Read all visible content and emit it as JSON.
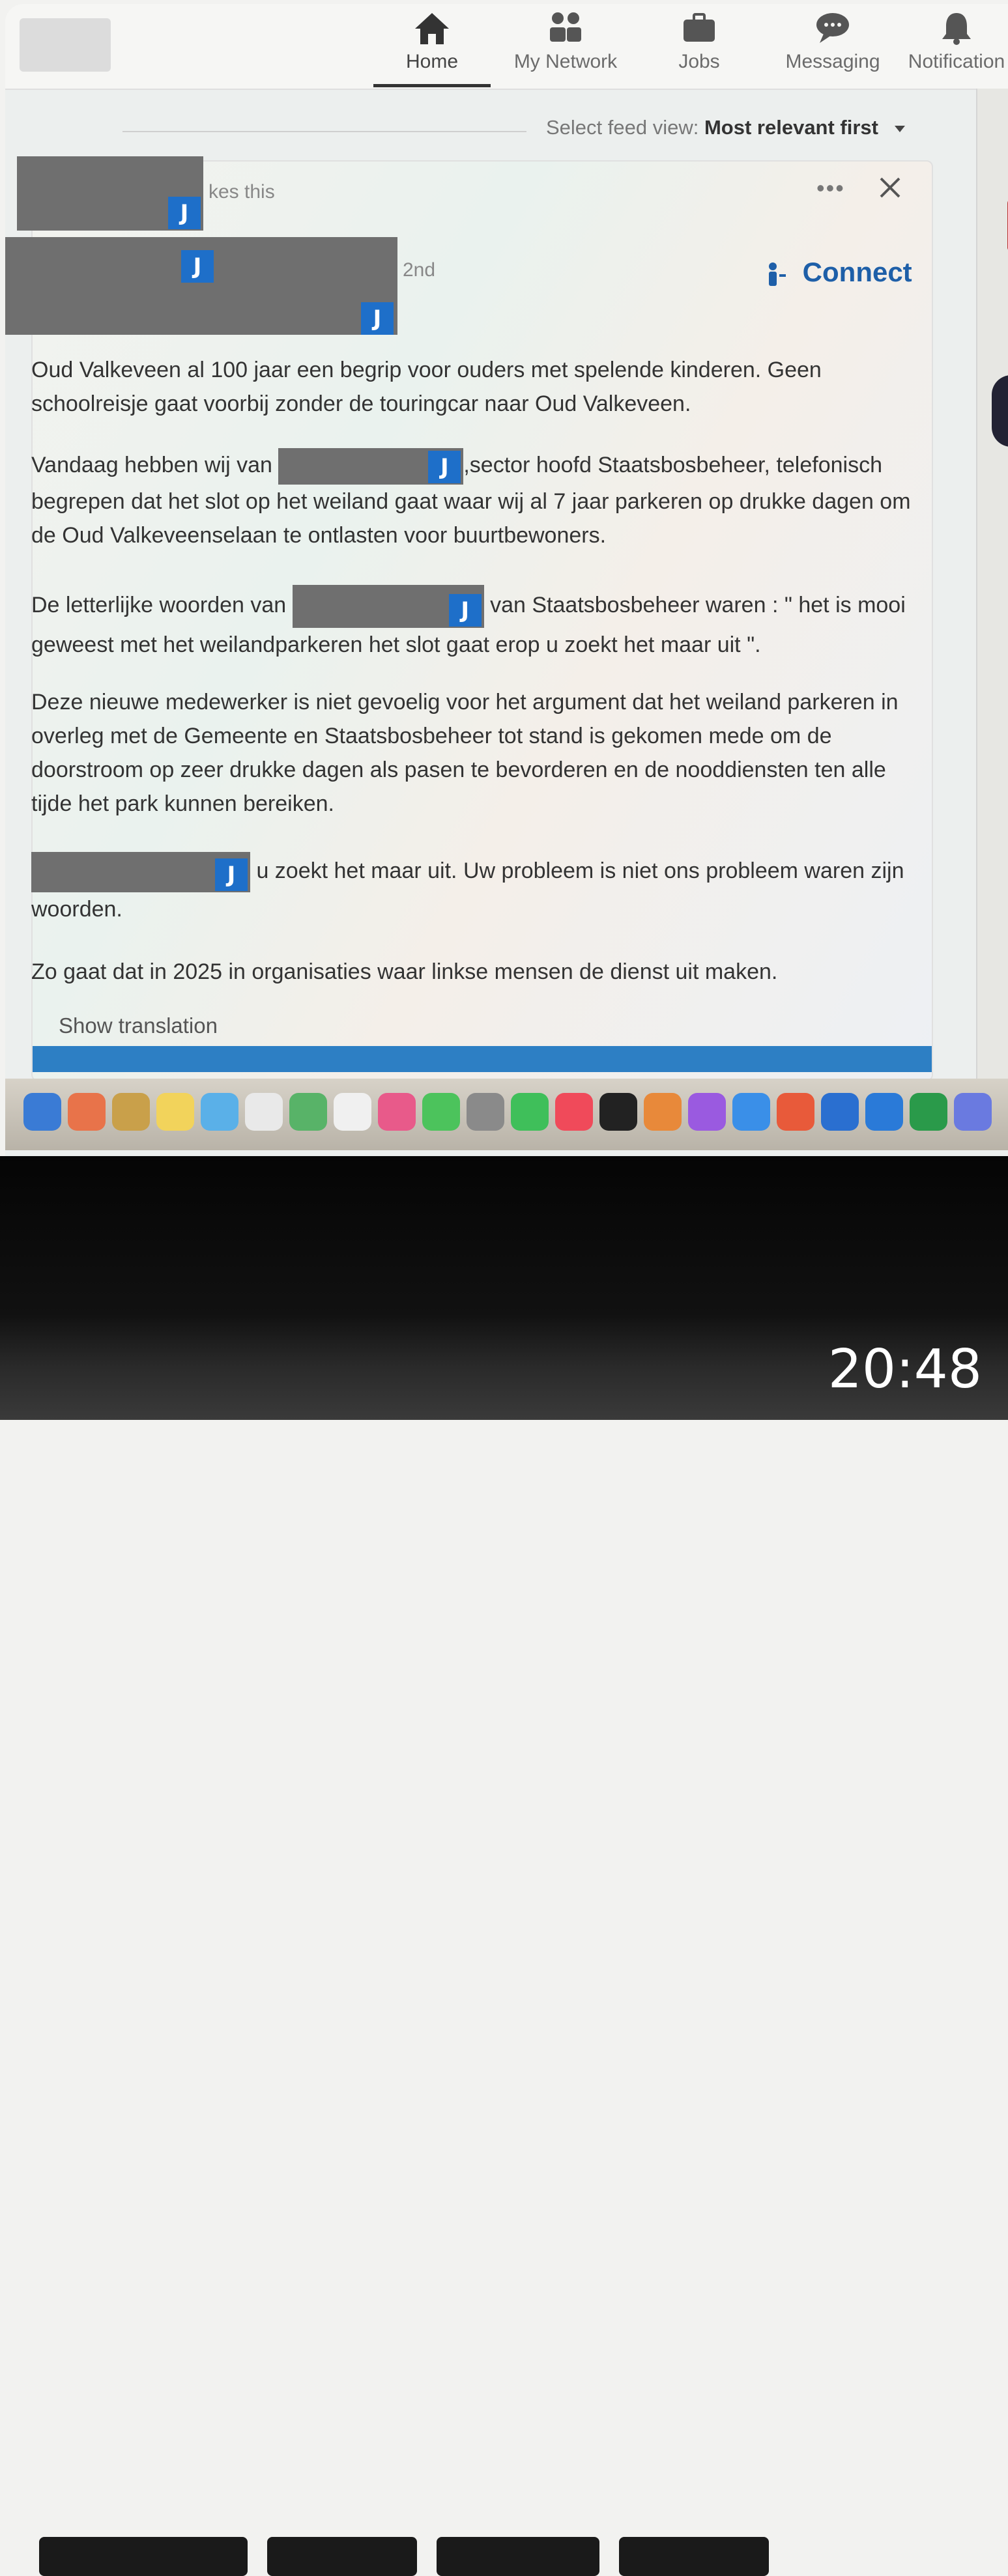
{
  "nav": {
    "items": [
      {
        "label": "Home",
        "icon": "home-icon",
        "active": true
      },
      {
        "label": "My Network",
        "icon": "network-icon",
        "active": false
      },
      {
        "label": "Jobs",
        "icon": "briefcase-icon",
        "active": false
      },
      {
        "label": "Messaging",
        "icon": "chat-icon",
        "active": false
      },
      {
        "label": "Notification",
        "icon": "bell-icon",
        "active": false
      }
    ]
  },
  "feed": {
    "select_prefix": "Select feed view:",
    "select_value": "Most relevant first"
  },
  "post": {
    "likes_text": "kes this",
    "degree": "2nd",
    "connect_label": "Connect",
    "redaction_badge": "J",
    "p1": "Oud Valkeveen al 100 jaar een begrip voor ouders met spelende kinderen. Geen schoolreisje gaat voorbij zonder de touringcar naar Oud Valkeveen.",
    "p2_a": "Vandaag hebben wij van",
    "p2_b": ",sector hoofd Staatsbosbeheer, telefonisch begrepen dat het slot op het weiland gaat waar wij al 7 jaar parkeren op drukke dagen om de Oud Valkeveenselaan te ontlasten voor buurtbewoners.",
    "p3_a": "De letterlijke woorden van",
    "p3_b": "van Staatsbosbeheer waren : \" het is mooi geweest met het weilandparkeren het slot gaat erop u zoekt het maar uit \".",
    "p4": "Deze nieuwe medewerker is niet gevoelig voor het argument dat het weiland parkeren in overleg met de Gemeente en Staatsbosbeheer tot stand is gekomen mede om de doorstroom op zeer drukke dagen als pasen te bevorderen en de nooddiensten ten alle tijde het park kunnen bereiken.",
    "p5_b": "u zoekt het maar uit. Uw probleem is niet ons probleem waren zijn woorden.",
    "p6": "Zo gaat dat in 2025 in organisaties waar linkse mensen de dienst uit maken.",
    "show_translation": "Show translation"
  },
  "dock": {
    "icon_colors": [
      "#3a7bd5",
      "#e8734a",
      "#c9a04a",
      "#f2d35b",
      "#5ab0e8",
      "#e9e9e9",
      "#58b368",
      "#f0f0f0",
      "#e85a8a",
      "#4cc35c",
      "#8a8a8a",
      "#3fbf5a",
      "#f04a5a",
      "#222222",
      "#e8893a",
      "#9a5ae0",
      "#3a8fe8",
      "#e85a3a",
      "#2a6fd0",
      "#2a7ad8",
      "#2a9a4a",
      "#6a7ae0"
    ]
  },
  "clock": "20:48"
}
